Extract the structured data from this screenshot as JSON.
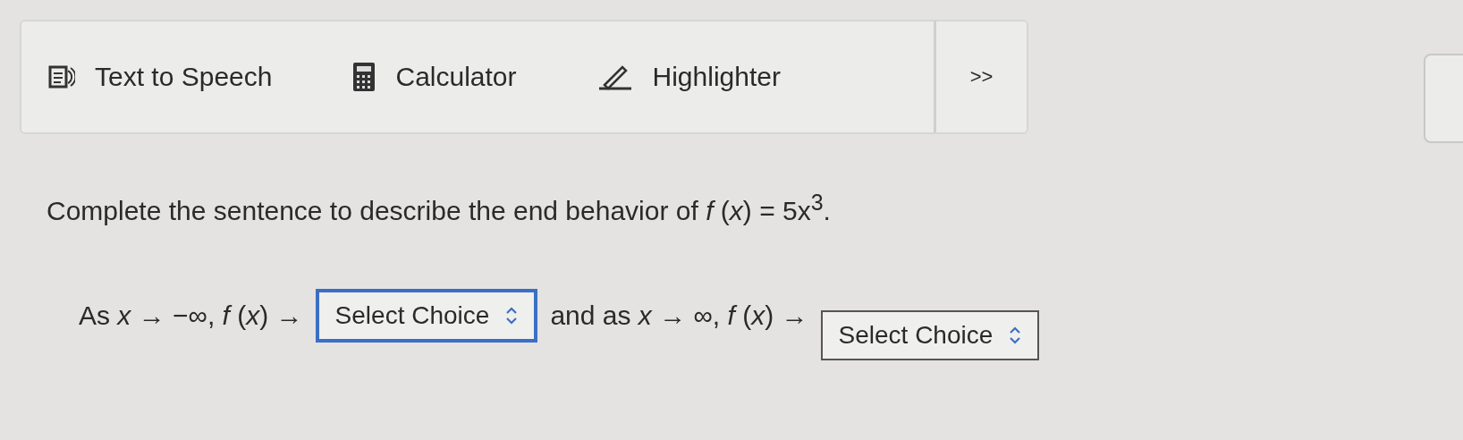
{
  "toolbar": {
    "tools": [
      {
        "kind": "speech",
        "label": "Text to Speech"
      },
      {
        "kind": "calculator",
        "label": "Calculator"
      },
      {
        "kind": "highlighter",
        "label": "Highlighter"
      }
    ],
    "more": ">>"
  },
  "question": {
    "prompt": "Complete the sentence to describe the end behavior of *f* (*x*) = 5x$^{3}$.",
    "parts": [
      {
        "kind": "text",
        "text": "As *x* → −∞, *f* (*x*) →"
      },
      {
        "kind": "select",
        "value": "Select Choice",
        "focused": true
      },
      {
        "kind": "text",
        "text": "and as *x* → ∞, *f* (*x*) →"
      },
      {
        "kind": "select",
        "value": "Select Choice",
        "focused": false
      }
    ]
  }
}
